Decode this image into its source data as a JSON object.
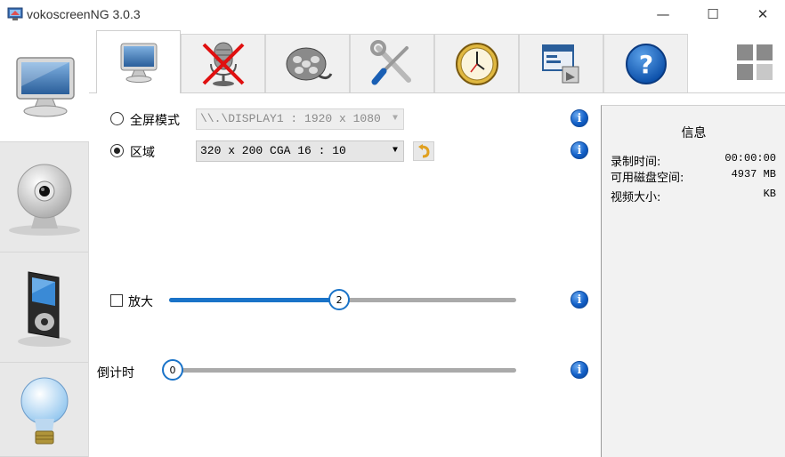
{
  "window": {
    "title": "vokoscreenNG 3.0.3",
    "minimize": "—",
    "maximize": "☐",
    "close": "✕"
  },
  "side_tabs": [
    {
      "icon": "monitor-icon",
      "active": true
    },
    {
      "icon": "webcam-icon",
      "active": false
    },
    {
      "icon": "media-player-icon",
      "active": false
    },
    {
      "icon": "lightbulb-icon",
      "active": false
    }
  ],
  "top_tabs": [
    {
      "icon": "monitor-icon",
      "active": true
    },
    {
      "icon": "microphone-muted-icon",
      "active": false
    },
    {
      "icon": "film-reel-icon",
      "active": false
    },
    {
      "icon": "tools-icon",
      "active": false
    },
    {
      "icon": "clock-icon",
      "active": false
    },
    {
      "icon": "window-export-icon",
      "active": false
    },
    {
      "icon": "help-icon",
      "active": false
    }
  ],
  "screen": {
    "fullscreen_label": "全屏模式",
    "fullscreen_value": "\\\\.\\DISPLAY1 :  1920 x 1080",
    "area_label": "区域",
    "area_value": "320 x 200 CGA 16 : 10",
    "selected_mode": "area",
    "magnifier_label": "放大",
    "magnifier_checked": false,
    "magnifier_value": "2",
    "magnifier_fraction": 0.49,
    "countdown_label": "倒计时",
    "countdown_value": "0",
    "countdown_fraction": 0.0,
    "info_icon_glyph": "i",
    "combo_arrow": "▼"
  },
  "info_panel": {
    "title": "信息",
    "rows": [
      {
        "label": "录制时间:",
        "value": "00:00:00"
      },
      {
        "label": "可用磁盘空间:",
        "value": "4937 MB"
      },
      {
        "label": "视频大小:",
        "value": "KB"
      }
    ]
  },
  "colors": {
    "accent": "#1a73c8",
    "info_blue": "#1260c8",
    "track": "#aaaaaa",
    "panel_bg": "#f2f2f2"
  }
}
